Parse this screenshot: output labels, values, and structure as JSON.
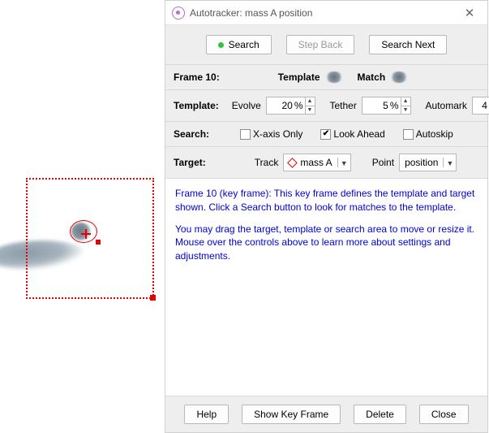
{
  "window": {
    "title": "Autotracker: mass A position"
  },
  "toolbar": {
    "search": "Search",
    "step_back": "Step Back",
    "search_next": "Search Next"
  },
  "frame_row": {
    "frame_label": "Frame 10:",
    "template_label": "Template",
    "match_label": "Match"
  },
  "template_row": {
    "label": "Template:",
    "evolve_label": "Evolve",
    "evolve_value": "20",
    "evolve_unit": "%",
    "tether_label": "Tether",
    "tether_value": "5",
    "tether_unit": "%",
    "automark_label": "Automark",
    "automark_value": "4"
  },
  "search_row": {
    "label": "Search:",
    "xaxis": "X-axis Only",
    "lookahead": "Look Ahead",
    "autoskip": "Autoskip"
  },
  "target_row": {
    "label": "Target:",
    "track_label": "Track",
    "track_value": "mass A",
    "point_label": "Point",
    "point_value": "position"
  },
  "info": {
    "p1": "Frame 10 (key frame): This key frame defines the template and target shown. Click a Search button to look for matches to the template.",
    "p2": "You may drag the target, template or search area to move or resize it. Mouse over the controls above to learn more about settings and adjustments."
  },
  "footer": {
    "help": "Help",
    "show_key": "Show Key Frame",
    "delete": "Delete",
    "close": "Close"
  }
}
